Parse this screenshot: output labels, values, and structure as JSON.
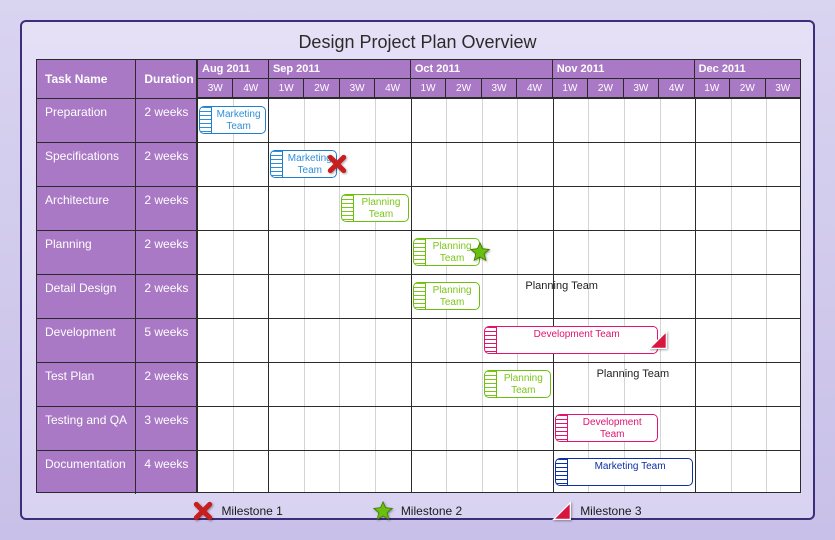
{
  "title": "Design Project Plan Overview",
  "columns": {
    "task": "Task Name",
    "duration": "Duration"
  },
  "chart_data": {
    "type": "bar",
    "orientation": "gantt",
    "x_unit": "week",
    "timeline": {
      "months": [
        {
          "label": "Aug 2011",
          "weeks": [
            "3W",
            "4W"
          ]
        },
        {
          "label": "Sep 2011",
          "weeks": [
            "1W",
            "2W",
            "3W",
            "4W"
          ]
        },
        {
          "label": "Oct 2011",
          "weeks": [
            "1W",
            "2W",
            "3W",
            "4W"
          ]
        },
        {
          "label": "Nov 2011",
          "weeks": [
            "1W",
            "2W",
            "3W",
            "4W"
          ]
        },
        {
          "label": "Dec 2011",
          "weeks": [
            "1W",
            "2W",
            "3W"
          ]
        }
      ],
      "total_weeks": 17
    },
    "tasks": [
      {
        "name": "Preparation",
        "duration": "2 weeks",
        "start": 0,
        "span": 2,
        "team": "Marketing Team",
        "style": "marketing"
      },
      {
        "name": "Specifications",
        "duration": "2 weeks",
        "start": 2,
        "span": 2,
        "team": "Marketing Team",
        "style": "marketing",
        "milestone": 1
      },
      {
        "name": "Architecture",
        "duration": "2 weeks",
        "start": 4,
        "span": 2,
        "team": "Planning Team",
        "style": "planning"
      },
      {
        "name": "Planning",
        "duration": "2 weeks",
        "start": 6,
        "span": 2,
        "team": "Planning Team",
        "style": "planning",
        "milestone": 2
      },
      {
        "name": "Detail Design",
        "duration": "2 weeks",
        "start": 6,
        "span": 2,
        "team": "Planning Team",
        "style": "planning",
        "annotation": "Planning Team"
      },
      {
        "name": "Development",
        "duration": "5 weeks",
        "start": 8,
        "span": 5,
        "team": "Development Team",
        "style": "dev",
        "milestone": 3
      },
      {
        "name": "Test Plan",
        "duration": "2 weeks",
        "start": 8,
        "span": 2,
        "team": "Planning Team",
        "style": "planning",
        "annotation": "Planning Team"
      },
      {
        "name": "Testing and QA",
        "duration": "3 weeks",
        "start": 10,
        "span": 3,
        "team": "Development Team",
        "style": "dev"
      },
      {
        "name": "Documentation",
        "duration": "4 weeks",
        "start": 10,
        "span": 4,
        "team": "Marketing Team",
        "style": "marketing2"
      }
    ],
    "milestones": [
      {
        "id": 1,
        "label": "Milestone 1",
        "shape": "x",
        "color": "#c91e1e"
      },
      {
        "id": 2,
        "label": "Milestone 2",
        "shape": "star",
        "color": "#6bbf0e"
      },
      {
        "id": 3,
        "label": "Milestone 3",
        "shape": "triangle",
        "color": "#d8153f"
      }
    ]
  }
}
